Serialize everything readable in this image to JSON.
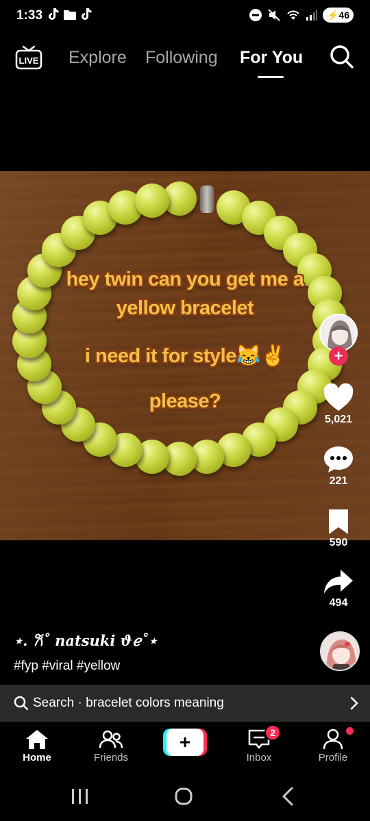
{
  "status_bar": {
    "time": "1:33",
    "battery": "46"
  },
  "top_nav": {
    "tabs": [
      {
        "label": "Explore",
        "active": false
      },
      {
        "label": "Following",
        "active": false
      },
      {
        "label": "For You",
        "active": true
      }
    ]
  },
  "video": {
    "caption_lines": [
      "hey twin can you get me a",
      "yellow bracelet",
      "i need it for style😹✌️",
      "please?"
    ]
  },
  "actions": {
    "likes": "5,021",
    "comments": "221",
    "saves": "590",
    "shares": "494"
  },
  "post": {
    "author": "⋆. 𐙚˚ natsuki ϑℯ˚⋆",
    "hashtags": "#fyp #viral #yellow"
  },
  "search_suggestion": {
    "text": "Search · bracelet colors meaning"
  },
  "tab_bar": {
    "home": "Home",
    "friends": "Friends",
    "inbox": "Inbox",
    "inbox_badge": "2",
    "profile": "Profile"
  },
  "colors": {
    "accent_red": "#fe2c55",
    "accent_cyan": "#24f0ef",
    "caption_yellow": "#f2c04a"
  }
}
